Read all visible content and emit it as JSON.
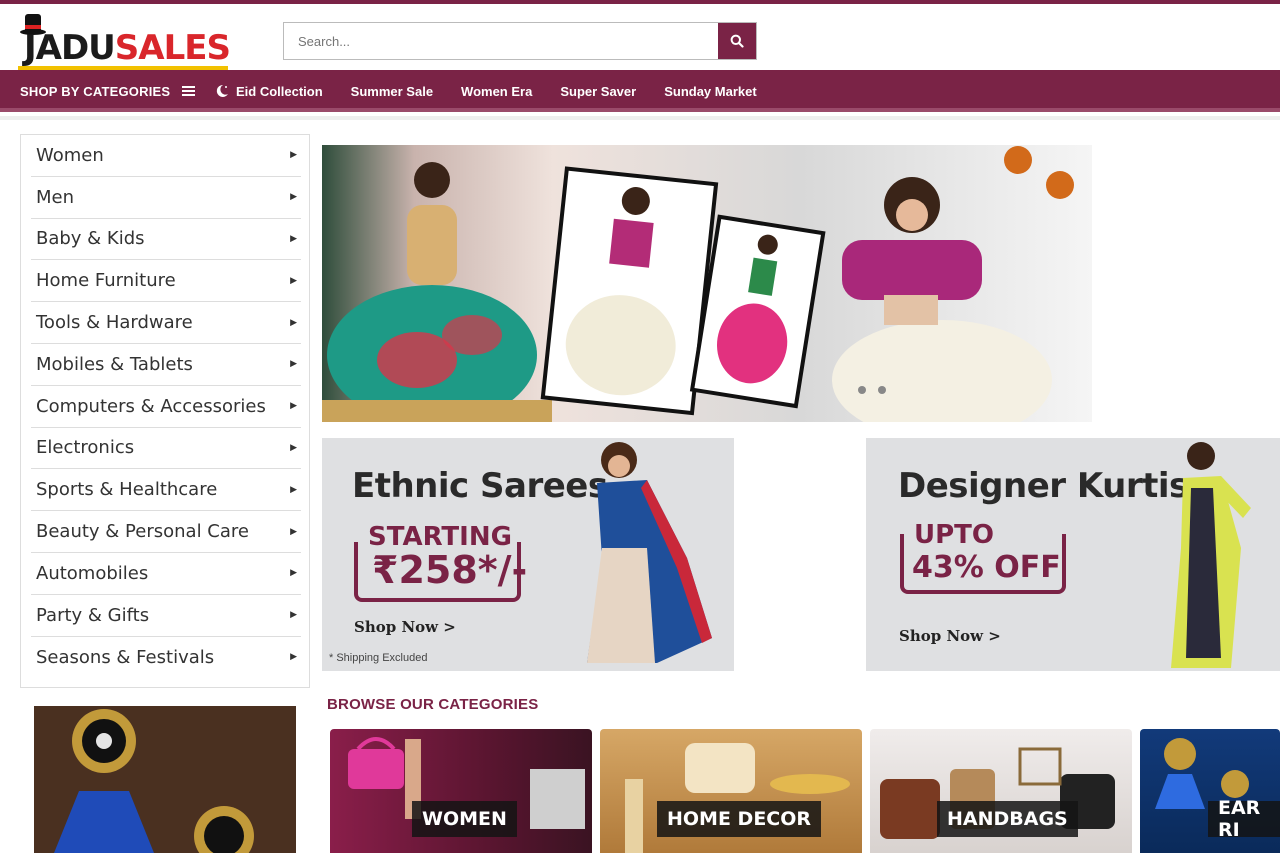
{
  "brand": {
    "logo_part1": "JADU",
    "logo_part2": "SALES"
  },
  "search": {
    "placeholder": "Search..."
  },
  "nav": {
    "shop_by": "SHOP BY CATEGORIES",
    "links": [
      "Eid Collection",
      "Summer Sale",
      "Women Era",
      "Super Saver",
      "Sunday Market"
    ]
  },
  "sidebar": {
    "items": [
      "Women",
      "Men",
      "Baby & Kids",
      "Home Furniture",
      "Tools & Hardware",
      "Mobiles & Tablets",
      "Computers & Accessories",
      "Electronics",
      "Sports & Healthcare",
      "Beauty & Personal Care",
      "Automobiles",
      "Party & Gifts",
      "Seasons & Festivals"
    ]
  },
  "promos": {
    "sarees": {
      "title": "Ethnic Sarees",
      "line1": "STARTING",
      "line2": "₹258*/-",
      "cta": "Shop Now >",
      "note": "* Shipping Excluded"
    },
    "kurtis": {
      "title": "Designer Kurtis",
      "line1": "UPTO",
      "line2": "43% OFF",
      "cta": "Shop Now >"
    }
  },
  "browse": {
    "heading": "BROWSE OUR CATEGORIES",
    "tiles": [
      "WOMEN",
      "HOME DECOR",
      "HANDBAGS",
      "EAR RI"
    ]
  },
  "colors": {
    "brand": "#7a2346",
    "logo_red": "#d9262b",
    "logo_yellow": "#f2c100"
  }
}
